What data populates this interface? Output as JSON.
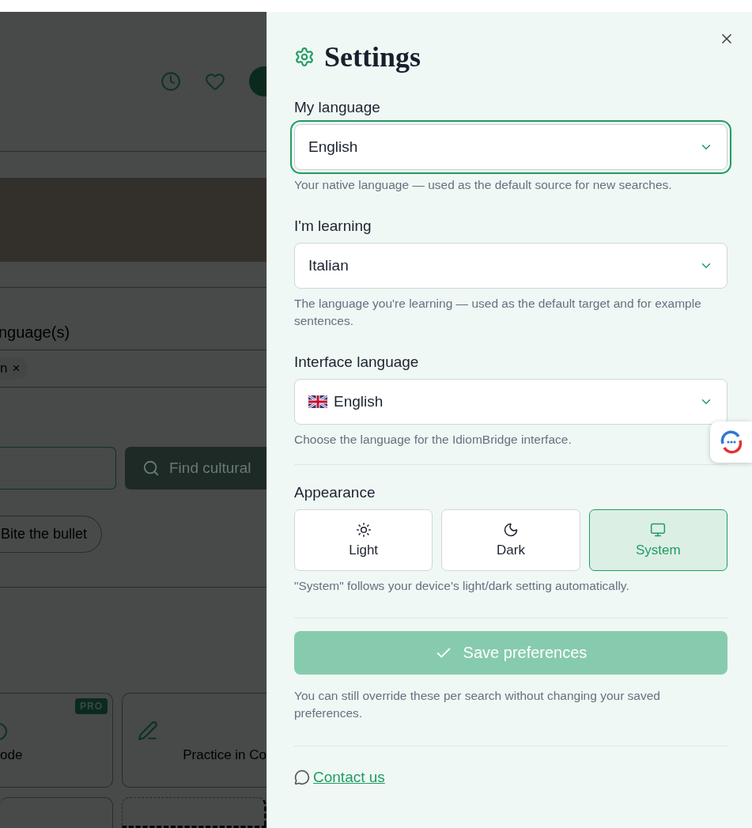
{
  "background": {
    "section_heading": "nguage(s)",
    "chip": {
      "label": "n",
      "remove": "×"
    },
    "search_button": "Find cultural",
    "suggestion_chip": "Bite the bullet",
    "cards": [
      {
        "label": "ode",
        "badge": "PRO"
      },
      {
        "label": "Practice in Co"
      }
    ]
  },
  "settings": {
    "title": "Settings",
    "fields": [
      {
        "label": "My language",
        "value": "English",
        "hint": "Your native language — used as the default source for new searches.",
        "kind": "plain",
        "focused": true
      },
      {
        "label": "I'm learning",
        "value": "Italian",
        "hint": "The language you're learning — used as the default target and for example sentences.",
        "kind": "plain",
        "focused": false
      },
      {
        "label": "Interface language",
        "value": "English",
        "hint": "Choose the language for the IdiomBridge interface.",
        "kind": "flag",
        "focused": false
      }
    ],
    "appearance": {
      "label": "Appearance",
      "options": [
        {
          "label": "Light",
          "kind": "light",
          "selected": false
        },
        {
          "label": "Dark",
          "kind": "dark",
          "selected": false
        },
        {
          "label": "System",
          "kind": "system",
          "selected": true
        }
      ],
      "hint": "\"System\" follows your device's light/dark setting automatically."
    },
    "save_button": {
      "label": "Save preferences",
      "disabled": true
    },
    "note": "You can still override these per search without changing your saved preferences.",
    "contact_link": "Contact us"
  }
}
